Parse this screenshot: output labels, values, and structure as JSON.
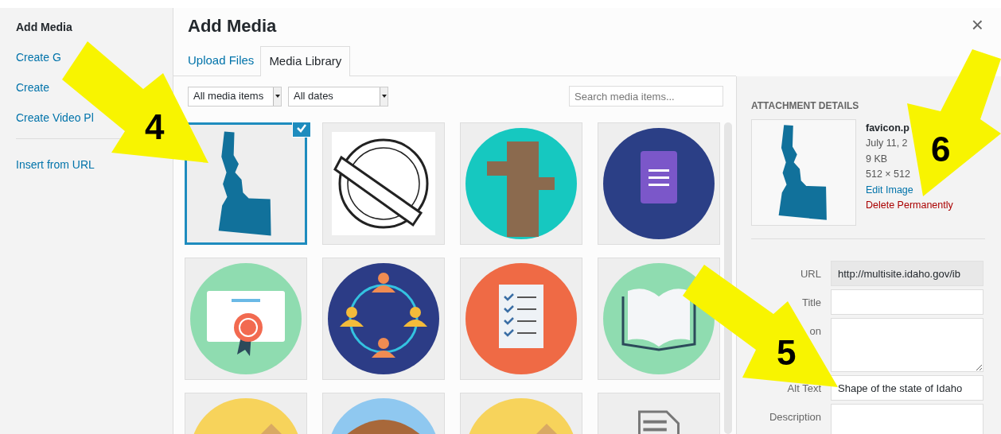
{
  "sidebar": {
    "title": "Add Media",
    "items": [
      {
        "label": "Create G"
      },
      {
        "label": "Create"
      },
      {
        "label": "Create Video Pl"
      }
    ],
    "extra_items": [
      {
        "label": "Insert from URL"
      }
    ]
  },
  "modal": {
    "title": "Add Media",
    "close": "×"
  },
  "tabs": [
    {
      "label": "Upload Files",
      "selected": false
    },
    {
      "label": "Media Library",
      "selected": true
    }
  ],
  "filters": [
    {
      "value": "All media items"
    },
    {
      "value": "All dates"
    }
  ],
  "search": {
    "placeholder": "Search media items..."
  },
  "media": [
    {
      "kind": "idaho",
      "selected": true
    },
    {
      "kind": "seal",
      "selected": false
    },
    {
      "kind": "tree",
      "selected": false
    },
    {
      "kind": "form",
      "selected": false
    },
    {
      "kind": "certificate",
      "selected": false
    },
    {
      "kind": "team",
      "selected": false
    },
    {
      "kind": "checklist",
      "selected": false
    },
    {
      "kind": "book",
      "selected": false
    },
    {
      "kind": "wood",
      "selected": false
    },
    {
      "kind": "stump",
      "selected": false
    },
    {
      "kind": "wood",
      "selected": false
    },
    {
      "kind": "document",
      "selected": false
    }
  ],
  "details": {
    "heading": "ATTACHMENT DETAILS",
    "filename": "favicon.p",
    "date": "July 11, 2",
    "filesize": "9 KB",
    "dimensions": "512 × 512",
    "edit_link": "Edit Image",
    "delete_link": "Delete Permanently"
  },
  "fields": [
    {
      "kind": "input",
      "label": "URL",
      "value": "http://multisite.idaho.gov/ib",
      "readonly": true
    },
    {
      "kind": "input",
      "label": "Title",
      "readonly": false
    },
    {
      "kind": "textarea",
      "label": "on",
      "readonly": false
    },
    {
      "kind": "input",
      "label": "Alt Text",
      "value": "Shape of the state of Idaho",
      "readonly": false
    },
    {
      "kind": "textarea",
      "label": "Description",
      "readonly": false
    }
  ],
  "callouts": [
    {
      "number": "4"
    },
    {
      "number": "5"
    },
    {
      "number": "6"
    }
  ]
}
